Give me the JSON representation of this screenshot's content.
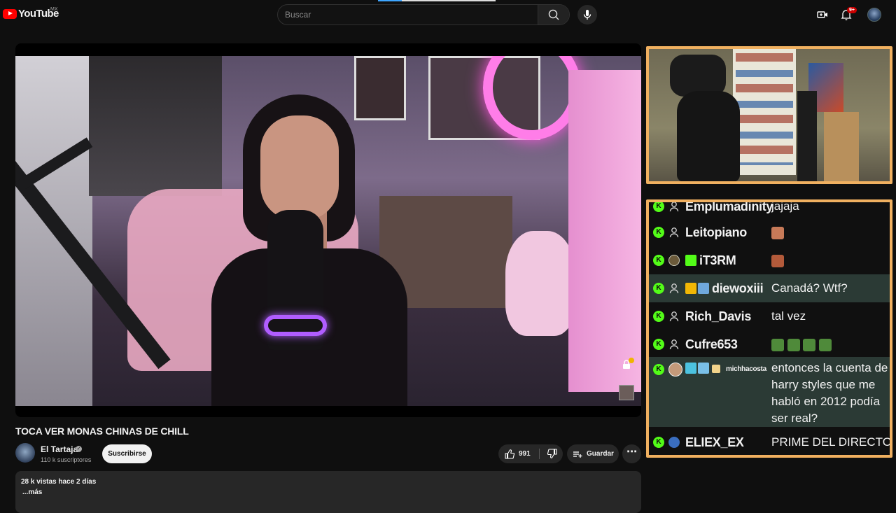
{
  "header": {
    "logo_text": "YouTube",
    "country": "MX",
    "search_placeholder": "Buscar",
    "notification_count": "9+"
  },
  "video": {
    "title": "TOCA VER MONAS CHINAS DE CHILL",
    "channel_name": "El Tartaja",
    "subscribers": "110 k suscriptores",
    "subscribe_label": "Suscribirse",
    "likes": "991",
    "save_label": "Guardar",
    "views_date": "28 k vistas  hace 2 días",
    "more_label": "...más"
  },
  "chat": {
    "messages": [
      {
        "user": "Emplumadinity",
        "message": "jajaja"
      },
      {
        "user": "Leitopiano",
        "message": ""
      },
      {
        "user": "iT3RM",
        "message": ""
      },
      {
        "user": "diewoxiii",
        "message": "Canadá? Wtf?"
      },
      {
        "user": "Rich_Davis",
        "message": "tal vez"
      },
      {
        "user": "Cufre653",
        "message": ""
      },
      {
        "user": "michhacosta",
        "message": "entonces la cuenta de harry styles que me habló en 2012 podía ser real?"
      },
      {
        "user": "ELIEX_EX",
        "message": "PRIME DEL DIRECTO"
      }
    ]
  },
  "colors": {
    "accent": "#ff0000",
    "kick_green": "#53fc18",
    "overlay_border": "#f0b060",
    "highlight_row": "#2b3a35"
  },
  "icons": [
    "youtube-logo-icon",
    "search-icon",
    "mic-icon",
    "create-icon",
    "bell-icon",
    "like-icon",
    "dislike-icon",
    "save-icon",
    "more-icon",
    "kick-icon",
    "user-icon"
  ]
}
